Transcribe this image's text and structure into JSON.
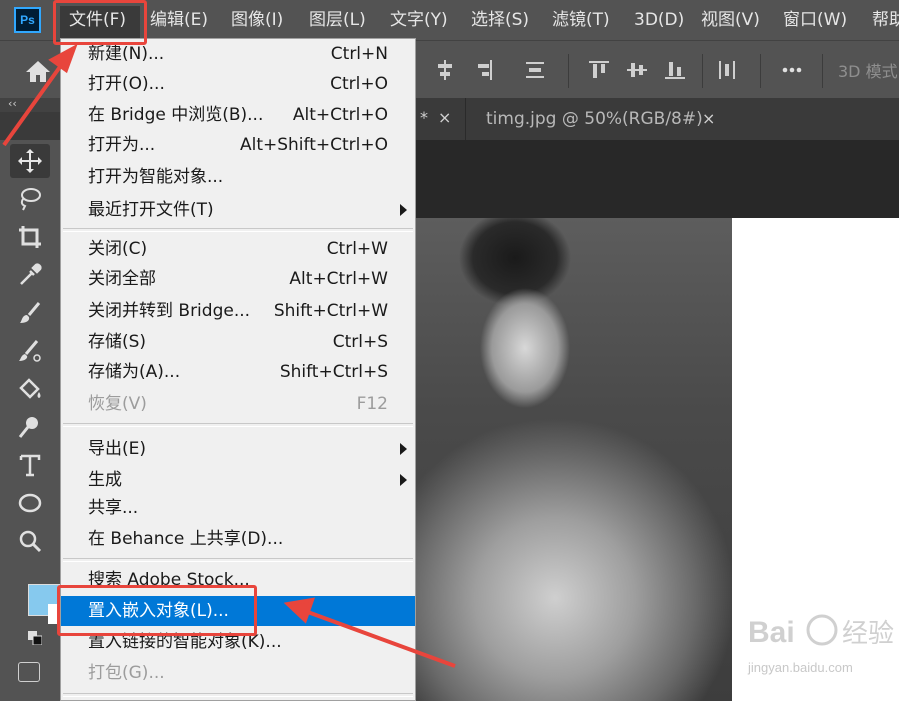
{
  "app": {
    "logo": "Ps"
  },
  "menubar": {
    "items": [
      "文件(F)",
      "编辑(E)",
      "图像(I)",
      "图层(L)",
      "文字(Y)",
      "选择(S)",
      "滤镜(T)",
      "3D(D)",
      "视图(V)",
      "窗口(W)",
      "帮助"
    ]
  },
  "optionsbar": {
    "mode_label": "3D 模式"
  },
  "tabs": {
    "collapse": "‹‹",
    "tab1_marker": "*",
    "tab1_close": "×",
    "tab2_label": "timg.jpg @ 50%(RGB/8#)",
    "tab2_close": "×"
  },
  "file_menu": {
    "items": [
      {
        "label": "新建(N)...",
        "shortcut": "Ctrl+N"
      },
      {
        "label": "打开(O)...",
        "shortcut": "Ctrl+O"
      },
      {
        "label": "在 Bridge 中浏览(B)...",
        "shortcut": "Alt+Ctrl+O"
      },
      {
        "label": "打开为...",
        "shortcut": "Alt+Shift+Ctrl+O"
      },
      {
        "label": "打开为智能对象...",
        "shortcut": ""
      },
      {
        "label": "最近打开文件(T)",
        "shortcut": ""
      },
      {
        "label": "关闭(C)",
        "shortcut": "Ctrl+W"
      },
      {
        "label": "关闭全部",
        "shortcut": "Alt+Ctrl+W"
      },
      {
        "label": "关闭并转到 Bridge...",
        "shortcut": "Shift+Ctrl+W"
      },
      {
        "label": "存储(S)",
        "shortcut": "Ctrl+S"
      },
      {
        "label": "存储为(A)...",
        "shortcut": "Shift+Ctrl+S"
      },
      {
        "label": "恢复(V)",
        "shortcut": "F12"
      },
      {
        "label": "导出(E)",
        "shortcut": ""
      },
      {
        "label": "生成",
        "shortcut": ""
      },
      {
        "label": "共享...",
        "shortcut": ""
      },
      {
        "label": "在 Behance 上共享(D)...",
        "shortcut": ""
      },
      {
        "label": "搜索 Adobe Stock...",
        "shortcut": ""
      },
      {
        "label": "置入嵌入对象(L)...",
        "shortcut": ""
      },
      {
        "label": "置入链接的智能对象(K)...",
        "shortcut": ""
      },
      {
        "label": "打包(G)...",
        "shortcut": ""
      }
    ]
  },
  "watermark": {
    "brand": "Bai du 经验",
    "url": "jingyan.baidu.com"
  },
  "colors": {
    "accent_highlight": "#0078d7",
    "annotation_red": "#e8453c",
    "foreground_swatch": "#86c9ee",
    "ui_panel": "#535353"
  }
}
